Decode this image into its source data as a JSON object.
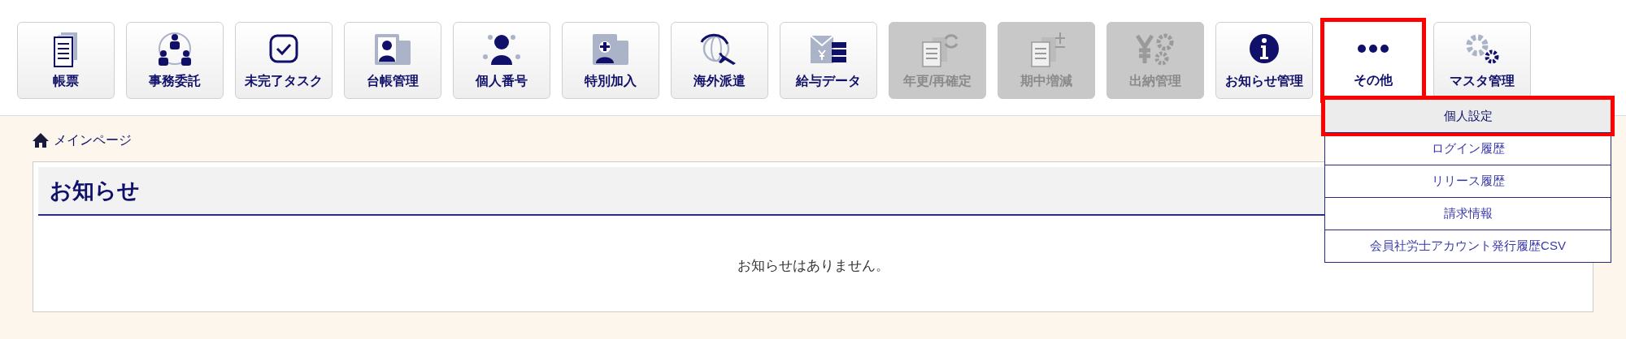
{
  "toolbar": [
    {
      "label": "帳票",
      "disabled": false,
      "selected": false
    },
    {
      "label": "事務委託",
      "disabled": false,
      "selected": false
    },
    {
      "label": "未完了タスク",
      "disabled": false,
      "selected": false
    },
    {
      "label": "台帳管理",
      "disabled": false,
      "selected": false
    },
    {
      "label": "個人番号",
      "disabled": false,
      "selected": false
    },
    {
      "label": "特別加入",
      "disabled": false,
      "selected": false
    },
    {
      "label": "海外派遣",
      "disabled": false,
      "selected": false
    },
    {
      "label": "給与データ",
      "disabled": false,
      "selected": false
    },
    {
      "label": "年更/再確定",
      "disabled": true,
      "selected": false
    },
    {
      "label": "期中増減",
      "disabled": true,
      "selected": false
    },
    {
      "label": "出納管理",
      "disabled": true,
      "selected": false
    },
    {
      "label": "お知らせ管理",
      "disabled": false,
      "selected": false
    },
    {
      "label": "その他",
      "disabled": false,
      "selected": true
    },
    {
      "label": "マスタ管理",
      "disabled": false,
      "selected": false
    }
  ],
  "dropdown": [
    {
      "label": "個人設定",
      "selected": true
    },
    {
      "label": "ログイン履歴",
      "selected": false
    },
    {
      "label": "リリース履歴",
      "selected": false
    },
    {
      "label": "請求情報",
      "selected": false
    },
    {
      "label": "会員社労士アカウント発行履歴CSV",
      "selected": false
    }
  ],
  "breadcrumb": "メインページ",
  "notices": {
    "title": "お知らせ",
    "empty_message": "お知らせはありません。"
  }
}
